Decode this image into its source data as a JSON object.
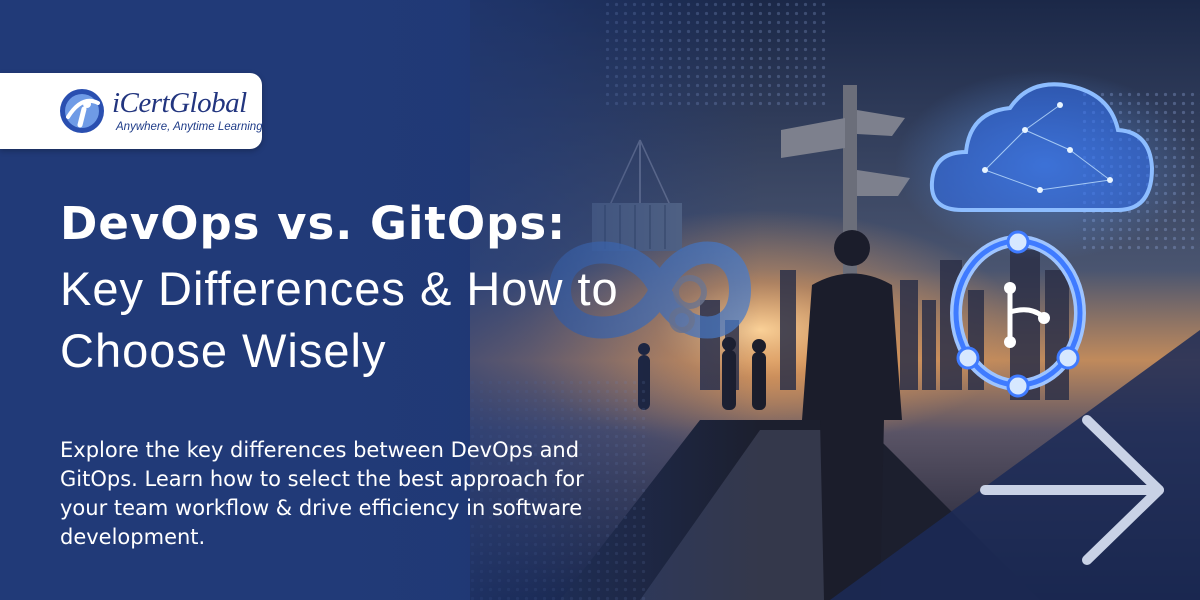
{
  "logo": {
    "name": "iCertGlobal",
    "tagline": "Anywhere, Anytime Learning"
  },
  "headline": {
    "bold": "DevOps vs. GitOps:",
    "light": "Key Differences & How to Choose Wisely"
  },
  "description": "Explore the key differences between DevOps and GitOps. Learn how to select the best approach for your team workflow & drive efficiency in software development.",
  "icons": [
    "signpost-icon",
    "cloud-icon",
    "git-branch-icon",
    "gear-icon",
    "infinity-icon",
    "container-icon",
    "arrow-right-icon"
  ],
  "colors": {
    "background": "#223b7a",
    "accent_blue": "#3f7bff",
    "logo_text": "#22357f",
    "text": "#ffffff"
  }
}
